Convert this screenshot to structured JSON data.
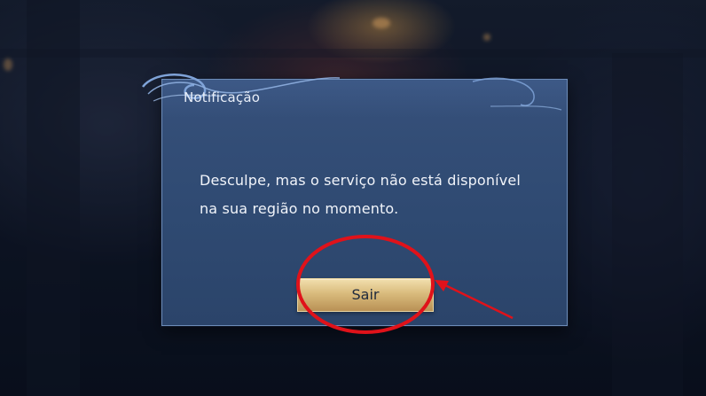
{
  "dialog": {
    "title": "Notificação",
    "message_line1": "Desculpe, mas o serviço não está disponível",
    "message_line2": "na sua região no momento.",
    "exit_label": "Sair"
  },
  "colors": {
    "dialog_bg": "#34507a",
    "dialog_border": "#6d8cb8",
    "button_gold": "#d9bb7d",
    "annotation_red": "#e0121a"
  },
  "icons": {
    "title_ornament": "swirl-ornament",
    "annotation_circle": "red-circle-highlight",
    "annotation_arrow": "red-arrow"
  }
}
